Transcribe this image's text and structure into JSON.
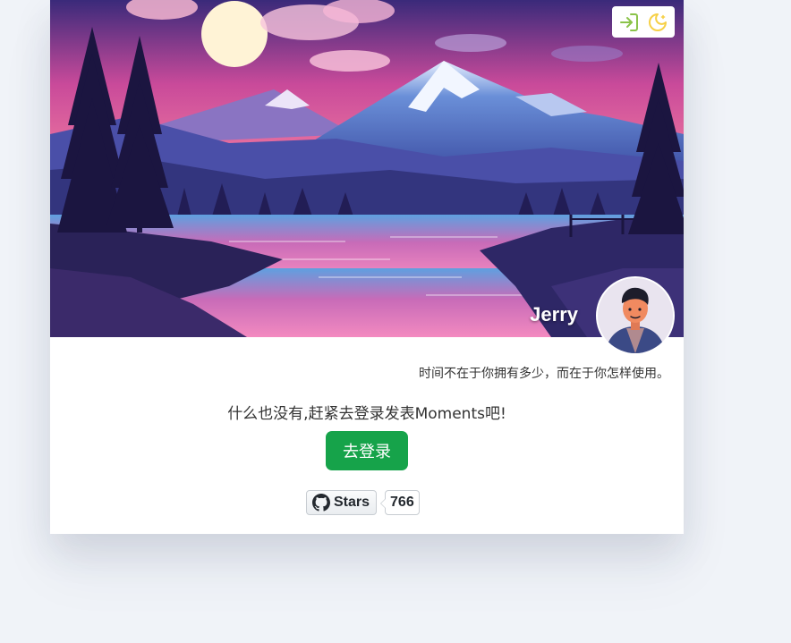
{
  "header": {
    "username": "Jerry",
    "motto": "时间不在于你拥有多少，而在于你怎样使用。"
  },
  "toolbar": {
    "login_icon": "login-arrow-icon",
    "theme_icon": "moon-icon",
    "login_icon_color": "#8bc34a",
    "theme_icon_color": "#f6d046"
  },
  "main": {
    "empty_message": "什么也没有,赶紧去登录发表Moments吧!",
    "login_button_label": "去登录",
    "login_button_color": "#16a34a"
  },
  "github": {
    "icon": "github-icon",
    "stars_label": "Stars",
    "stars_count": "766"
  }
}
